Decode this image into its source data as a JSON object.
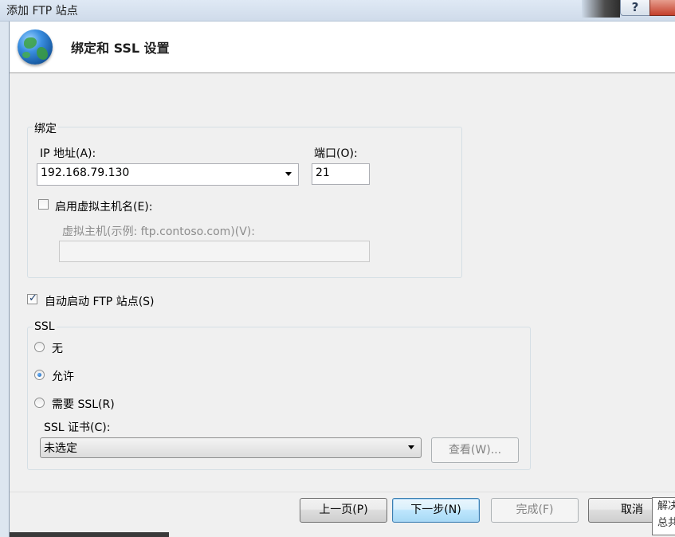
{
  "window": {
    "title": "添加 FTP 站点",
    "help_label": "?"
  },
  "header": {
    "icon": "globe-icon",
    "title": "绑定和 SSL 设置"
  },
  "binding": {
    "legend": "绑定",
    "ip_label": "IP 地址(A):",
    "ip_value": "192.168.79.130",
    "port_label": "端口(O):",
    "port_value": "21",
    "virtual_host_checkbox_label": "启用虚拟主机名(E):",
    "virtual_host_checked": false,
    "virtual_host_field_label": "虚拟主机(示例: ftp.contoso.com)(V):",
    "virtual_host_value": ""
  },
  "autostart": {
    "label": "自动启动 FTP 站点(S)",
    "checked": true
  },
  "ssl": {
    "legend": "SSL",
    "options": [
      {
        "label": "无",
        "selected": false
      },
      {
        "label": "允许",
        "selected": true
      },
      {
        "label": "需要 SSL(R)",
        "selected": false
      }
    ],
    "cert_label": "SSL 证书(C):",
    "cert_value": "未选定",
    "view_button": "查看(W)..."
  },
  "footer": {
    "prev_button": "上一页(P)",
    "next_button": "下一步(N)",
    "finish_button": "完成(F)",
    "cancel_button": "取消"
  },
  "tooltip": {
    "line1": "解决",
    "line2": "总共"
  }
}
